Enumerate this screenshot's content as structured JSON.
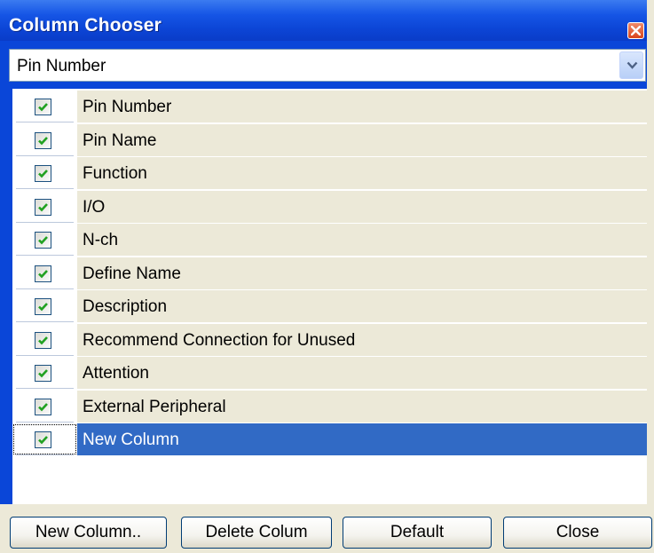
{
  "window": {
    "title": "Column Chooser"
  },
  "combo": {
    "selected": "Pin Number"
  },
  "columns": [
    {
      "label": "Pin Number",
      "checked": true
    },
    {
      "label": "Pin Name",
      "checked": true
    },
    {
      "label": "Function",
      "checked": true
    },
    {
      "label": "I/O",
      "checked": true
    },
    {
      "label": "N-ch",
      "checked": true
    },
    {
      "label": "Define Name",
      "checked": true
    },
    {
      "label": "Description",
      "checked": true
    },
    {
      "label": "Recommend Connection for Unused",
      "checked": true
    },
    {
      "label": "Attention",
      "checked": true
    },
    {
      "label": "External Peripheral",
      "checked": true
    },
    {
      "label": "New Column",
      "checked": true,
      "selected": true
    }
  ],
  "buttons": {
    "new_column": "New Column..",
    "delete_column": "Delete Colum",
    "default": "Default",
    "close": "Close"
  },
  "colors": {
    "titlebar": "#0a46d8",
    "selection": "#316ac5",
    "row_background": "#ece9d8",
    "check": "#21a121"
  },
  "icons": {
    "close": "close-icon",
    "dropdown": "chevron-down-icon",
    "check": "checkmark-icon"
  }
}
